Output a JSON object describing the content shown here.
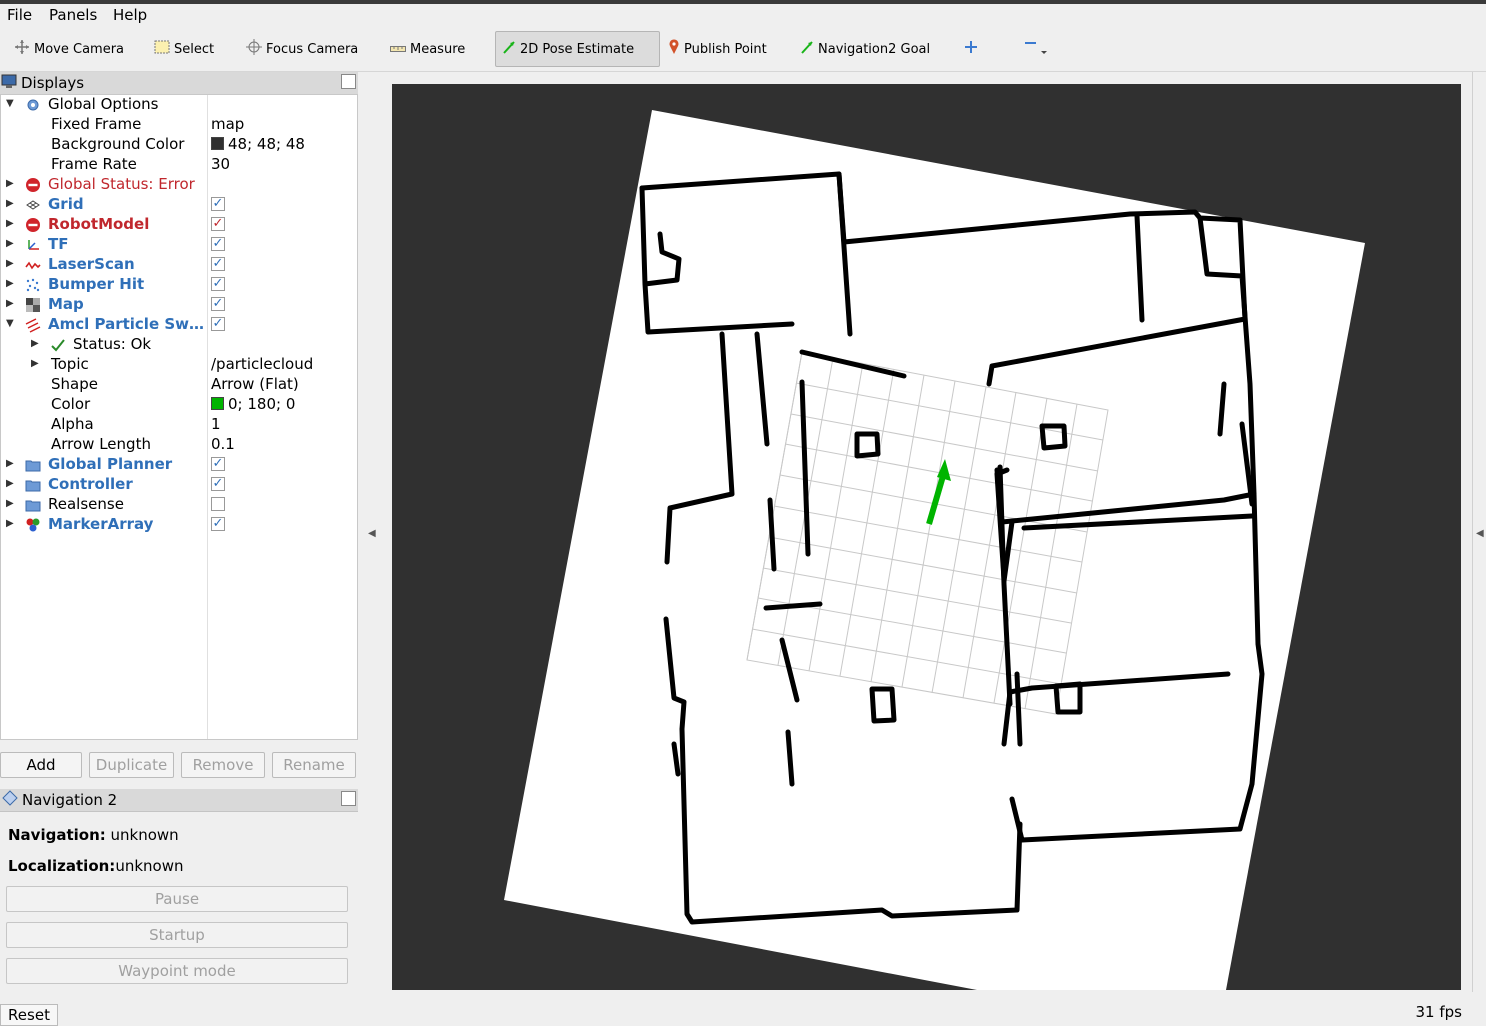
{
  "menu": {
    "file": "File",
    "panels": "Panels",
    "help": "Help"
  },
  "toolbar": {
    "move_camera": "Move Camera",
    "select": "Select",
    "focus_camera": "Focus Camera",
    "measure": "Measure",
    "pose_estimate": "2D Pose Estimate",
    "publish_point": "Publish Point",
    "nav_goal": "Navigation2 Goal",
    "active_tool": "2D Pose Estimate"
  },
  "displays": {
    "title": "Displays",
    "global_options": {
      "label": "Global Options",
      "fixed_frame_label": "Fixed Frame",
      "fixed_frame": "map",
      "bg_color_label": "Background Color",
      "bg_color": "48; 48; 48",
      "bg_color_hex": "#303030",
      "frame_rate_label": "Frame Rate",
      "frame_rate": "30"
    },
    "global_status": "Global Status: Error",
    "items": [
      {
        "label": "Grid",
        "checked": true,
        "icon": "grid-icon"
      },
      {
        "label": "RobotModel",
        "checked": true,
        "icon": "error-icon"
      },
      {
        "label": "TF",
        "checked": true,
        "icon": "tf-icon"
      },
      {
        "label": "LaserScan",
        "checked": true,
        "icon": "laserscan-icon"
      },
      {
        "label": "Bumper Hit",
        "checked": true,
        "icon": "pointcloud-icon"
      },
      {
        "label": "Map",
        "checked": true,
        "icon": "map-icon"
      },
      {
        "label": "Amcl Particle Sw…",
        "checked": true,
        "icon": "posearray-icon"
      }
    ],
    "amcl": {
      "status": "Status: Ok",
      "topic_label": "Topic",
      "topic": "/particlecloud",
      "shape_label": "Shape",
      "shape": "Arrow (Flat)",
      "color_label": "Color",
      "color": "0; 180; 0",
      "color_hex": "#00b400",
      "alpha_label": "Alpha",
      "alpha": "1",
      "arrow_length_label": "Arrow Length",
      "arrow_length": "0.1"
    },
    "groups": [
      {
        "label": "Global Planner",
        "checked": true
      },
      {
        "label": "Controller",
        "checked": true
      },
      {
        "label": "Realsense",
        "checked": false
      },
      {
        "label": "MarkerArray",
        "checked": true
      }
    ],
    "buttons": {
      "add": "Add",
      "duplicate": "Duplicate",
      "remove": "Remove",
      "rename": "Rename"
    }
  },
  "navigation": {
    "title": "Navigation 2",
    "nav_label": "Navigation:",
    "nav_value": "unknown",
    "loc_label": "Localization:",
    "loc_value": "unknown",
    "pause": "Pause",
    "startup": "Startup",
    "waypoint": "Waypoint mode"
  },
  "footer": {
    "reset": "Reset",
    "fps": "31 fps"
  }
}
